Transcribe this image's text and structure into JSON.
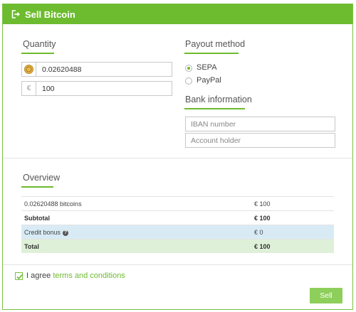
{
  "header": {
    "title": "Sell Bitcoin",
    "icon": "sign-out-icon"
  },
  "quantity": {
    "title": "Quantity",
    "bitcoin_value": "0.02620488",
    "euro_symbol": "€",
    "euro_value": "100"
  },
  "payout": {
    "title": "Payout method",
    "options": [
      {
        "label": "SEPA",
        "selected": true
      },
      {
        "label": "PayPal",
        "selected": false
      }
    ]
  },
  "bank": {
    "title": "Bank information",
    "iban_placeholder": "IBAN number",
    "holder_placeholder": "Account holder"
  },
  "overview": {
    "title": "Overview",
    "rows": [
      {
        "label": "0.02620488 bitcoins",
        "value": "€ 100"
      },
      {
        "label": "Subtotal",
        "value": "€ 100"
      },
      {
        "label": "Credit bonus",
        "value": "€ 0"
      },
      {
        "label": "Total",
        "value": "€ 100"
      }
    ]
  },
  "terms": {
    "prefix": "I agree",
    "link": "terms and conditions",
    "checked": true
  },
  "actions": {
    "sell_label": "Sell"
  },
  "colors": {
    "accent": "#6dbb2f",
    "info_row": "#d8ebf5",
    "success_row": "#dff0d8",
    "button": "#8dcf5a"
  }
}
